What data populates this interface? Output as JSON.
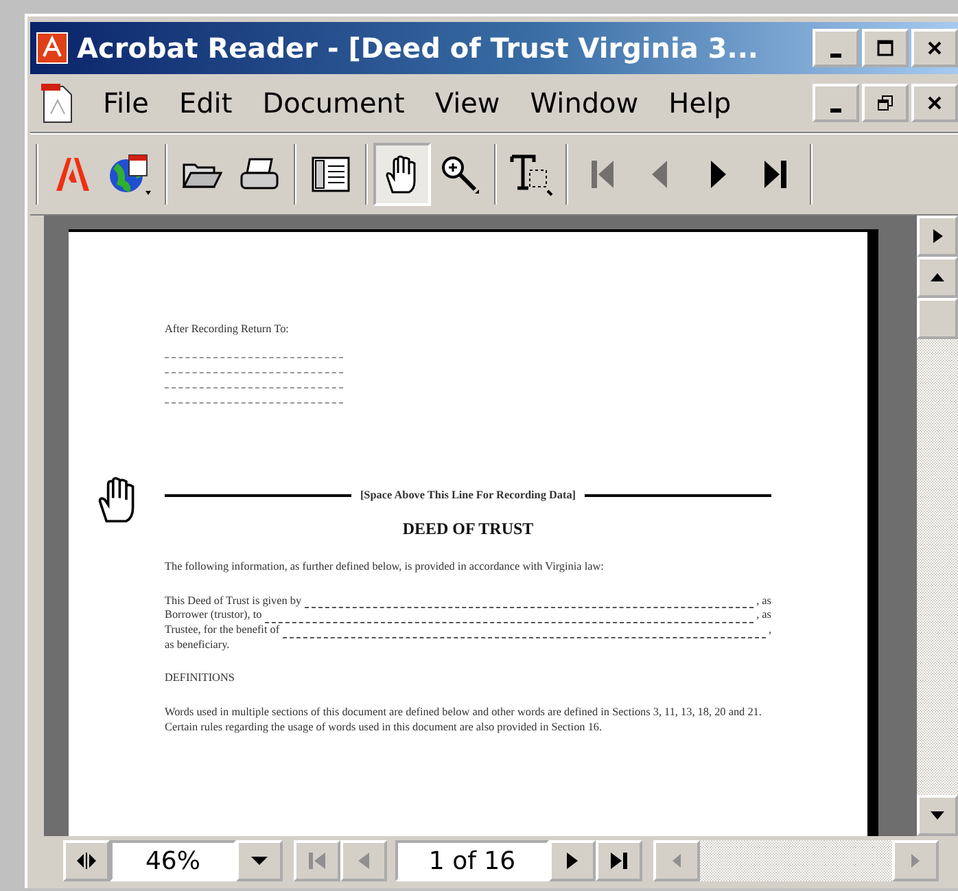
{
  "window": {
    "title": "Acrobat Reader - [Deed of Trust Virginia 3..."
  },
  "menu": [
    "File",
    "Edit",
    "Document",
    "View",
    "Window",
    "Help"
  ],
  "toolbar": [
    {
      "kind": "adobe",
      "selected": false,
      "disabled": false
    },
    {
      "kind": "web",
      "selected": false,
      "disabled": false
    },
    {
      "kind": "open",
      "selected": false,
      "disabled": false
    },
    {
      "kind": "print",
      "selected": false,
      "disabled": false
    },
    {
      "kind": "pages",
      "selected": false,
      "disabled": false
    },
    {
      "kind": "hand",
      "selected": true,
      "disabled": false
    },
    {
      "kind": "zoom",
      "selected": false,
      "disabled": false
    },
    {
      "kind": "text",
      "selected": false,
      "disabled": false
    },
    {
      "kind": "first",
      "selected": false,
      "disabled": true
    },
    {
      "kind": "prev",
      "selected": false,
      "disabled": true
    },
    {
      "kind": "next",
      "selected": false,
      "disabled": false
    },
    {
      "kind": "last",
      "selected": false,
      "disabled": false
    }
  ],
  "document": {
    "return_label": "After Recording Return To:",
    "separator": "[Space Above This Line For Recording Data]",
    "heading": "DEED OF TRUST",
    "intro": "The following information, as further defined below, is provided in accordance with Virginia law:",
    "fill_rows": [
      {
        "label": "This Deed of Trust is given by",
        "tail": ", as"
      },
      {
        "label": "Borrower (trustor), to",
        "tail": ", as"
      },
      {
        "label": "Trustee, for the benefit of",
        "tail": ","
      }
    ],
    "after_fill": "as beneficiary.",
    "section": "DEFINITIONS",
    "definitions": "Words used in multiple sections of this document are defined below and other words are defined in Sections 3, 11, 13, 18, 20 and 21.  Certain rules regarding the usage of words used in this document are also provided in Section 16."
  },
  "status_bar": {
    "zoom": "46%",
    "page": "1 of 16",
    "first_disabled": true,
    "prev_disabled": true
  }
}
